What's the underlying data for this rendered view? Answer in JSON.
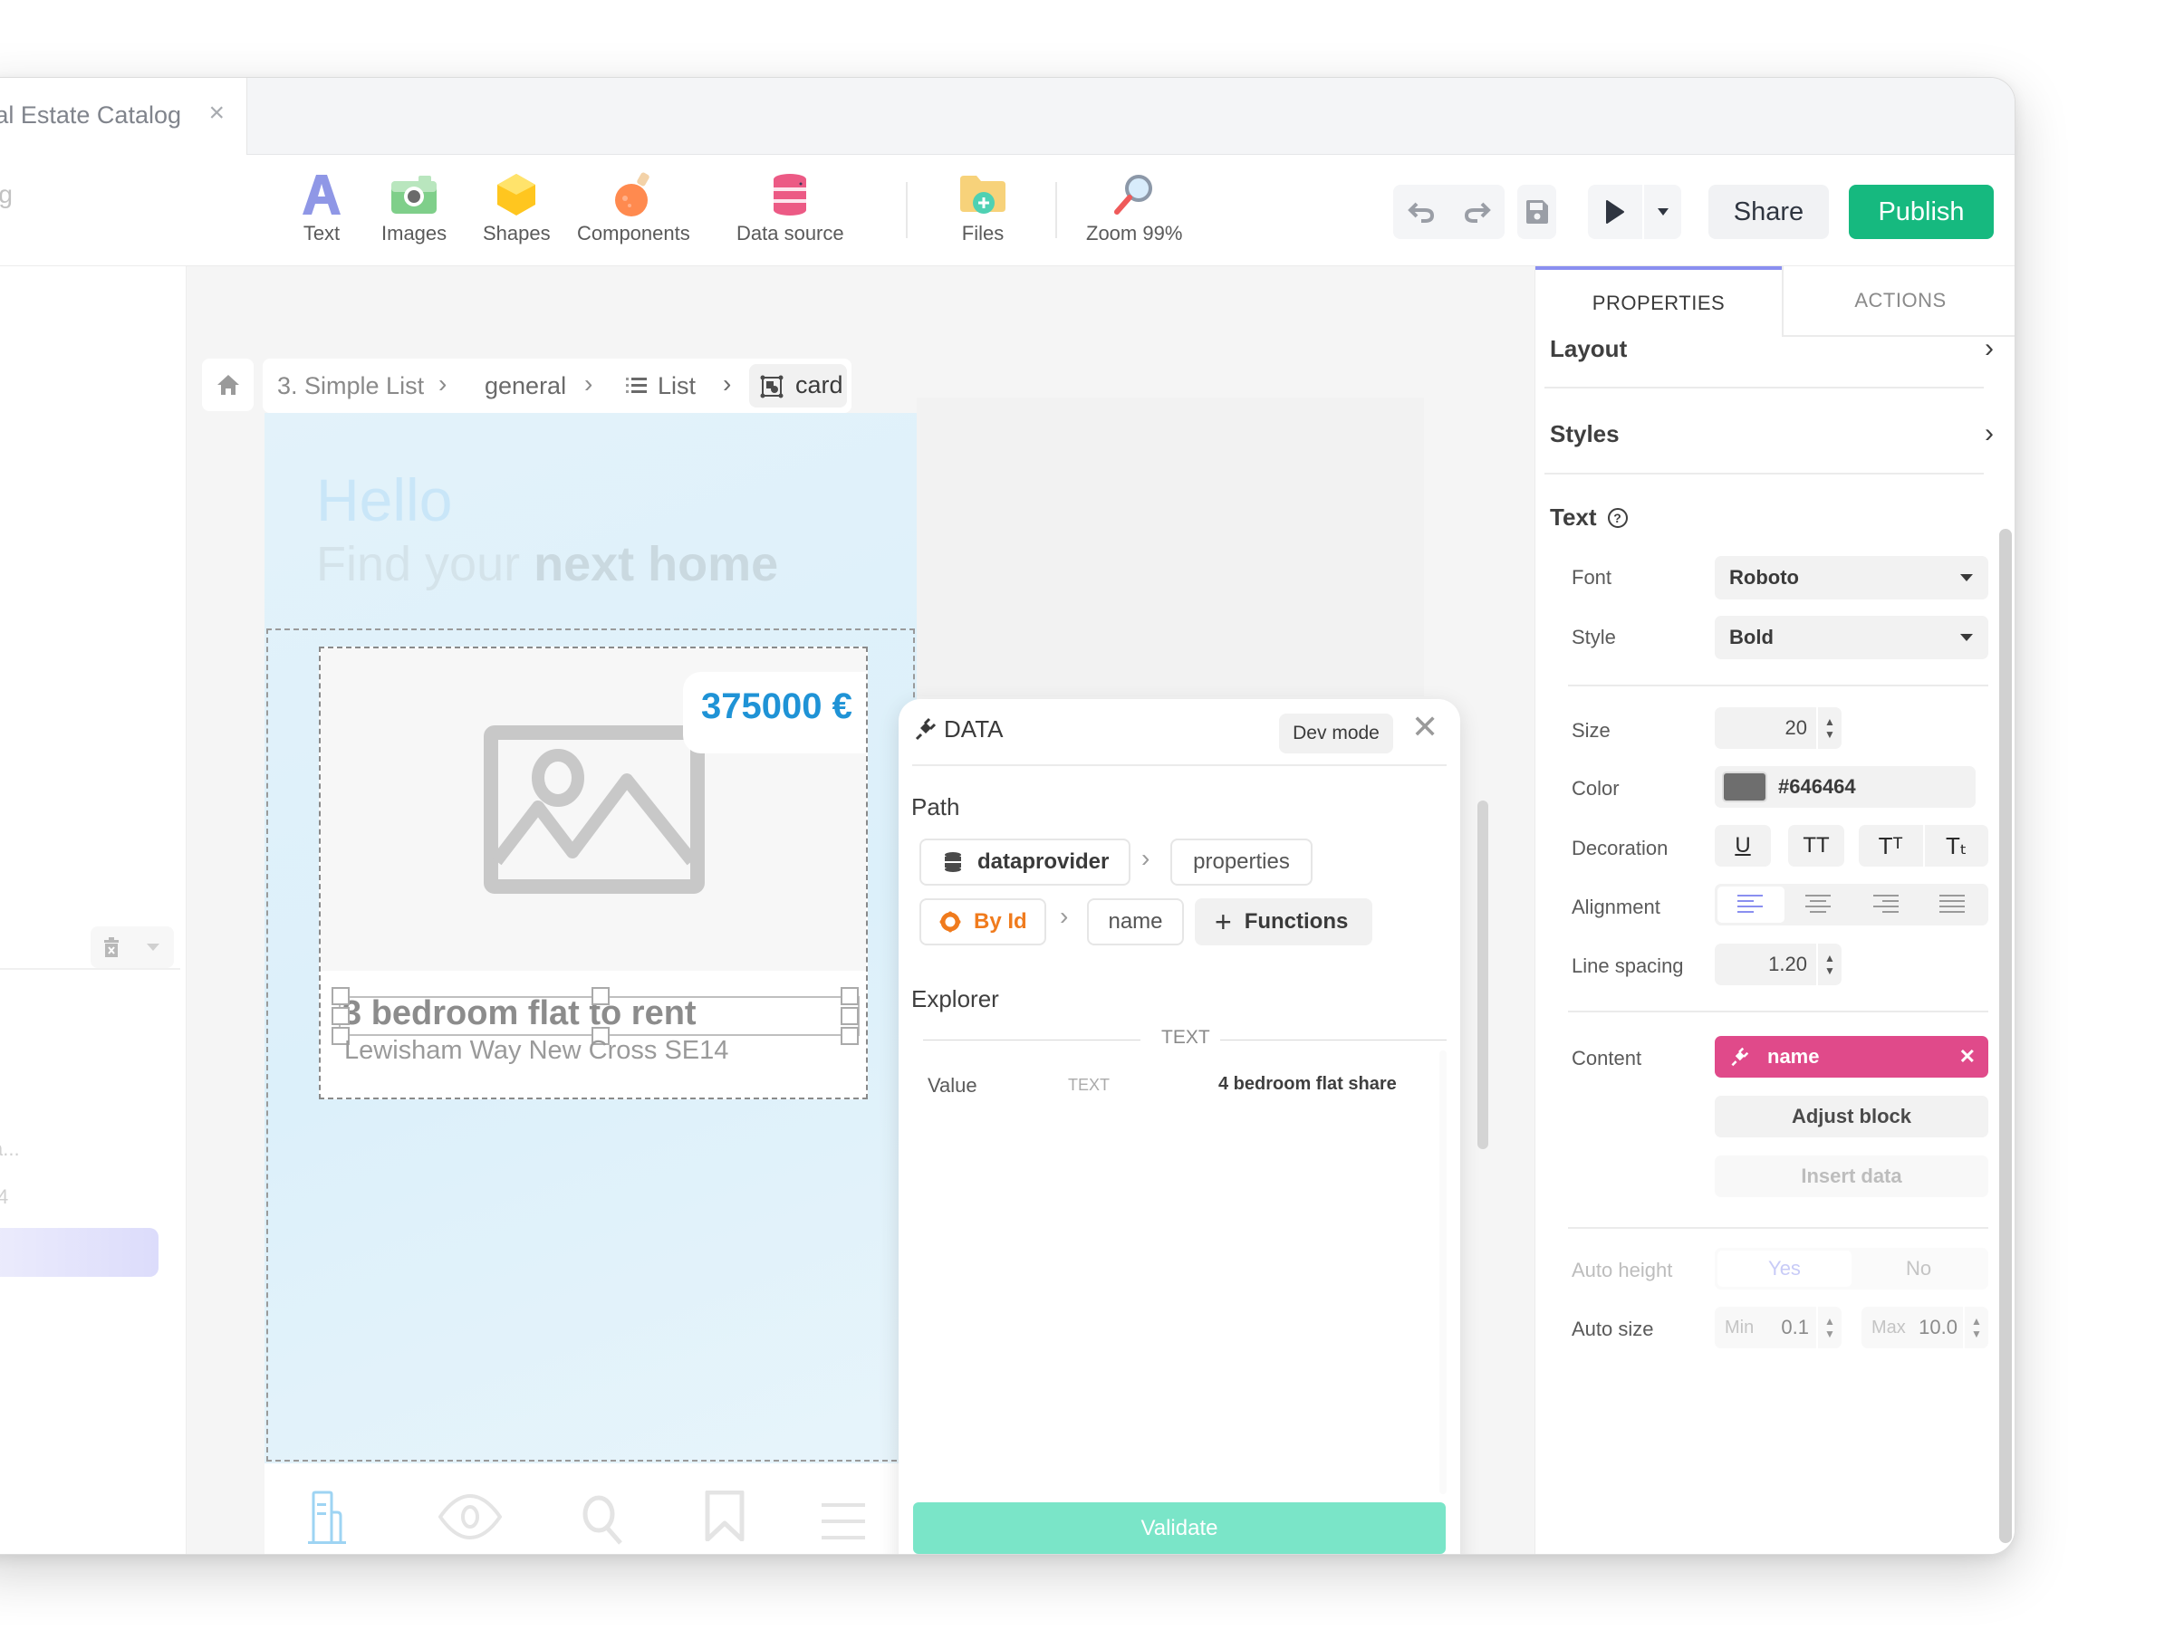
{
  "tab": {
    "title": "al Estate Catalog",
    "close": "×"
  },
  "project": {
    "name": "alog"
  },
  "toolbar": {
    "tools": [
      {
        "label": "Text",
        "icon": "text-icon"
      },
      {
        "label": "Images",
        "icon": "camera-icon"
      },
      {
        "label": "Shapes",
        "icon": "hexagon-icon"
      },
      {
        "label": "Components",
        "icon": "potion-icon"
      },
      {
        "label": "Data source",
        "icon": "database-icon"
      },
      {
        "label": "Files",
        "icon": "folder-add-icon"
      },
      {
        "label": "Zoom 99%",
        "icon": "magnifier-icon"
      }
    ],
    "share": "Share",
    "publish": "Publish"
  },
  "breadcrumb": {
    "items": [
      "3. Simple List",
      "general",
      "List",
      "card"
    ]
  },
  "phone": {
    "hello": "Hello",
    "subtitle_light": "Find your ",
    "subtitle_bold": "next home",
    "price": "375000 €",
    "card_title": "3 bedroom flat to rent",
    "card_address": "Lewisham Way New Cross SE14",
    "nav": [
      "building-icon",
      "eye-icon",
      "search-icon",
      "bookmark-icon",
      "menu-icon"
    ]
  },
  "left_panel": {
    "text1": "a...",
    "text2": "4"
  },
  "data_panel": {
    "title": "DATA",
    "dev_mode": "Dev mode",
    "path_label": "Path",
    "path": {
      "source": "dataprovider",
      "field1": "properties",
      "function": "By Id",
      "field2": "name",
      "functions_btn": "Functions"
    },
    "explorer_label": "Explorer",
    "explorer_type": "TEXT",
    "row": {
      "key": "Value",
      "type": "TEXT",
      "value": "4 bedroom flat share"
    },
    "validate": "Validate"
  },
  "properties": {
    "tabs": [
      "PROPERTIES",
      "ACTIONS"
    ],
    "active_tab": "PROPERTIES",
    "sections": {
      "layout": "Layout",
      "styles": "Styles",
      "text": "Text"
    },
    "font_label": "Font",
    "font_value": "Roboto",
    "style_label": "Style",
    "style_value": "Bold",
    "size_label": "Size",
    "size_value": "20",
    "color_label": "Color",
    "color_value": "#646464",
    "decoration_label": "Decoration",
    "decoration_options": [
      "U",
      "TT",
      "Tᵀ",
      "Tₜ"
    ],
    "alignment_label": "Alignment",
    "alignment_selected": "left",
    "line_spacing_label": "Line spacing",
    "line_spacing_value": "1.20",
    "content_label": "Content",
    "content_value": "name",
    "adjust_block": "Adjust block",
    "insert_data": "Insert data",
    "auto_height_label": "Auto height",
    "auto_height_yes": "Yes",
    "auto_height_no": "No",
    "auto_size_label": "Auto size",
    "auto_size_min_label": "Min",
    "auto_size_min": "0.1",
    "auto_size_max_label": "Max",
    "auto_size_max": "10.0"
  },
  "colors": {
    "accent": "#7c83f0",
    "publish": "#16b97f",
    "content_chip": "#e04a8a",
    "validate": "#7ae5c8",
    "price": "#1f93d6",
    "function_orange": "#f07b1d"
  }
}
